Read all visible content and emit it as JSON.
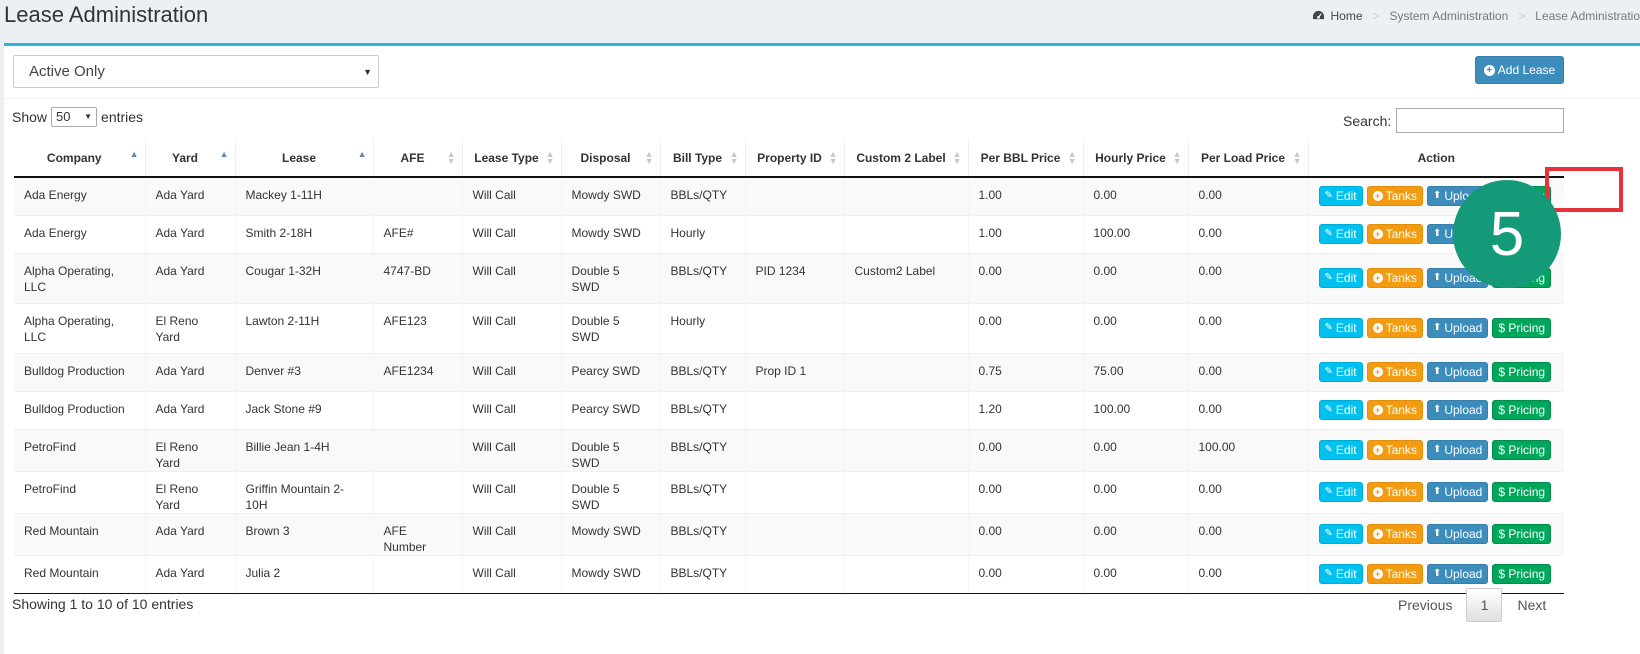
{
  "header": {
    "title": "Lease Administration",
    "breadcrumb": [
      "Home",
      "System Administration",
      "Lease Administratio"
    ],
    "breadcrumb_separator": ">"
  },
  "filter": {
    "selected": "Active Only"
  },
  "add_button": {
    "label": "Add Lease"
  },
  "length": {
    "show": "Show",
    "value": "50",
    "entries": "entries"
  },
  "search": {
    "label": "Search:",
    "value": ""
  },
  "table": {
    "columns": [
      "Company",
      "Yard",
      "Lease",
      "AFE",
      "Lease Type",
      "Disposal",
      "Bill Type",
      "Property ID",
      "Custom 2 Label",
      "Per BBL Price",
      "Hourly Price",
      "Per Load Price",
      "Action"
    ],
    "rows": [
      {
        "company": "Ada Energy",
        "yard": "Ada Yard",
        "lease": "Mackey 1-11H",
        "afe": "",
        "lease_type": "Will Call",
        "disposal": "Mowdy SWD",
        "bill_type": "BBLs/QTY",
        "property_id": "",
        "custom2": "",
        "per_bbl": "1.00",
        "hourly": "0.00",
        "per_load": "0.00"
      },
      {
        "company": "Ada Energy",
        "yard": "Ada Yard",
        "lease": "Smith 2-18H",
        "afe": "AFE#",
        "lease_type": "Will Call",
        "disposal": "Mowdy SWD",
        "bill_type": "Hourly",
        "property_id": "",
        "custom2": "",
        "per_bbl": "1.00",
        "hourly": "100.00",
        "per_load": "0.00"
      },
      {
        "company": "Alpha Operating, LLC",
        "yard": "Ada Yard",
        "lease": "Cougar 1-32H",
        "afe": "4747-BD",
        "lease_type": "Will Call",
        "disposal": "Double 5 SWD",
        "bill_type": "BBLs/QTY",
        "property_id": "PID 1234",
        "custom2": "Custom2 Label",
        "per_bbl": "0.00",
        "hourly": "0.00",
        "per_load": "0.00"
      },
      {
        "company": "Alpha Operating, LLC",
        "yard": "El Reno Yard",
        "lease": "Lawton 2-11H",
        "afe": "AFE123",
        "lease_type": "Will Call",
        "disposal": "Double 5 SWD",
        "bill_type": "Hourly",
        "property_id": "",
        "custom2": "",
        "per_bbl": "0.00",
        "hourly": "0.00",
        "per_load": "0.00"
      },
      {
        "company": "Bulldog Production",
        "yard": "Ada Yard",
        "lease": "Denver #3",
        "afe": "AFE1234",
        "lease_type": "Will Call",
        "disposal": "Pearcy SWD",
        "bill_type": "BBLs/QTY",
        "property_id": "Prop ID 1",
        "custom2": "",
        "per_bbl": "0.75",
        "hourly": "75.00",
        "per_load": "0.00"
      },
      {
        "company": "Bulldog Production",
        "yard": "Ada Yard",
        "lease": "Jack Stone #9",
        "afe": "",
        "lease_type": "Will Call",
        "disposal": "Pearcy SWD",
        "bill_type": "BBLs/QTY",
        "property_id": "",
        "custom2": "",
        "per_bbl": "1.20",
        "hourly": "100.00",
        "per_load": "0.00"
      },
      {
        "company": "PetroFind",
        "yard": "El Reno Yard",
        "lease": "Billie Jean 1-4H",
        "afe": "",
        "lease_type": "Will Call",
        "disposal": "Double 5 SWD",
        "bill_type": "BBLs/QTY",
        "property_id": "",
        "custom2": "",
        "per_bbl": "0.00",
        "hourly": "0.00",
        "per_load": "100.00"
      },
      {
        "company": "PetroFind",
        "yard": "El Reno Yard",
        "lease": "Griffin Mountain 2-10H",
        "afe": "",
        "lease_type": "Will Call",
        "disposal": "Double 5 SWD",
        "bill_type": "BBLs/QTY",
        "property_id": "",
        "custom2": "",
        "per_bbl": "0.00",
        "hourly": "0.00",
        "per_load": "0.00"
      },
      {
        "company": "Red Mountain",
        "yard": "Ada Yard",
        "lease": "Brown 3",
        "afe": "AFE Number",
        "lease_type": "Will Call",
        "disposal": "Mowdy SWD",
        "bill_type": "BBLs/QTY",
        "property_id": "",
        "custom2": "",
        "per_bbl": "0.00",
        "hourly": "0.00",
        "per_load": "0.00"
      },
      {
        "company": "Red Mountain",
        "yard": "Ada Yard",
        "lease": "Julia 2",
        "afe": "",
        "lease_type": "Will Call",
        "disposal": "Mowdy SWD",
        "bill_type": "BBLs/QTY",
        "property_id": "",
        "custom2": "",
        "per_bbl": "0.00",
        "hourly": "0.00",
        "per_load": "0.00"
      }
    ],
    "actions": {
      "edit": "Edit",
      "tanks": "Tanks",
      "upload": "Upload",
      "pricing": "$ Pricing"
    }
  },
  "footer": {
    "info": "Showing 1 to 10 of 10 entries",
    "previous": "Previous",
    "page": "1",
    "next": "Next"
  },
  "annotation": {
    "step_number": "5",
    "highlight_color": "#e8323a",
    "badge_color": "#149a78"
  },
  "colors": {
    "accent": "#2ab3dc",
    "edit": "#00c0ef",
    "tanks": "#f39c12",
    "upload": "#3c8dbc",
    "pricing": "#00a65a"
  }
}
